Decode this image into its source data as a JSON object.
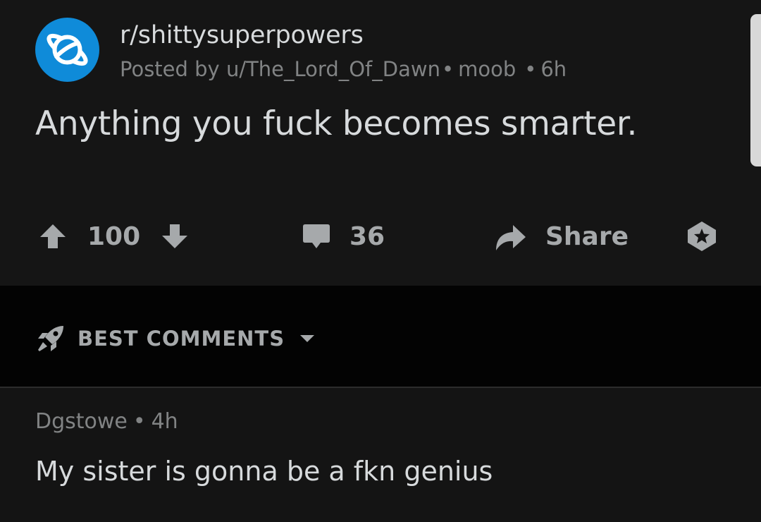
{
  "post": {
    "subreddit": "r/shittysuperpowers",
    "posted_by_prefix": "Posted by ",
    "author": "u/The_Lord_Of_Dawn",
    "flair_separator": "•",
    "flair": "moob",
    "time_separator": "•",
    "age": "6h",
    "title": "Anything you fuck becomes smarter."
  },
  "actions": {
    "upvote_icon": "arrow-up-icon",
    "score": "100",
    "downvote_icon": "arrow-down-icon",
    "comment_icon": "speech-bubble-icon",
    "comment_count": "36",
    "share_icon": "share-arrow-icon",
    "share_label": "Share",
    "award_icon": "award-icon"
  },
  "comments_sort": {
    "icon": "rocket-icon",
    "label": "BEST COMMENTS",
    "dropdown_icon": "caret-down-icon"
  },
  "comments": [
    {
      "author": "Dgstowe",
      "separator": "•",
      "age": "4h",
      "body": "My sister is gonna be a fkn genius"
    }
  ],
  "colors": {
    "background": "#141414",
    "comments_bar": "#030303",
    "avatar": "#0f8bd9",
    "primary_text": "#d7dadc",
    "secondary_text": "#818384",
    "icon": "#a6a9ab"
  }
}
